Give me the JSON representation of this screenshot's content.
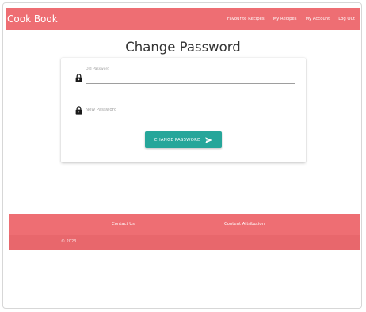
{
  "navbar": {
    "brand": "Cook Book",
    "links": [
      "Favourite Recipes",
      "My Recipes",
      "My Account",
      "Log Out"
    ]
  },
  "page": {
    "title": "Change Password"
  },
  "form": {
    "old_password_label": "Old Password",
    "new_password_placeholder": "New Password",
    "submit_label": "CHANGE PASSWORD"
  },
  "footer": {
    "links": [
      "Contact Us",
      "Content Attribution"
    ],
    "copyright": "© 2023"
  },
  "colors": {
    "primary": "#ee6e73",
    "button": "#26a69a"
  }
}
